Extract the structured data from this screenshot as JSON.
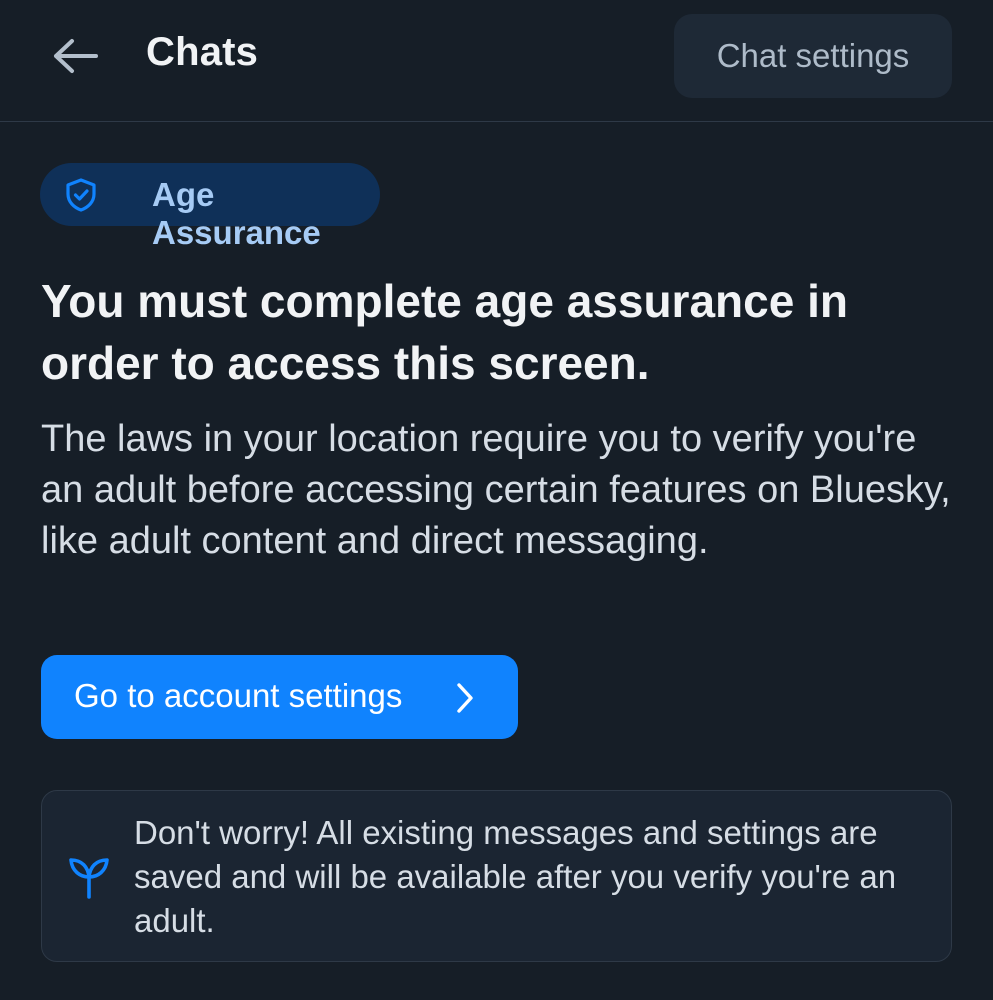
{
  "header": {
    "title": "Chats",
    "settings_label": "Chat settings"
  },
  "badge": {
    "label": "Age Assurance"
  },
  "main": {
    "heading": "You must complete age assurance in order to access this screen.",
    "description": "The laws in your location require you to verify you're an adult before accessing certain features on Bluesky, like adult content and direct messaging.",
    "button_label": "Go to account settings"
  },
  "info": {
    "text": "Don't worry! All existing messages and settings are saved and will be available after you verify you're an adult."
  },
  "icons": {
    "back": "arrow-left-icon",
    "badge": "shield-check-icon",
    "button": "chevron-right-icon",
    "info": "sprout-icon"
  },
  "colors": {
    "background": "#161e27",
    "accent": "#1083fe",
    "badge_bg": "#0f3058",
    "badge_text": "#a6cbf5",
    "card_bg": "#1b2532"
  }
}
